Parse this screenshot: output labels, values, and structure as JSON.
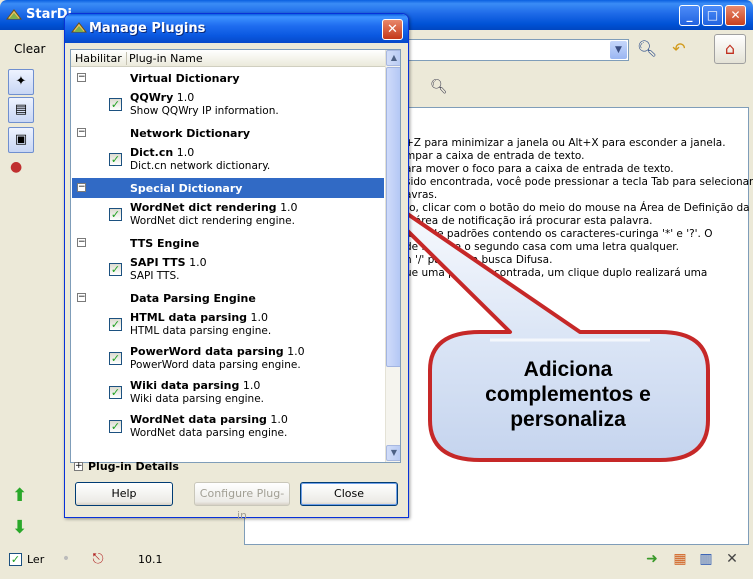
{
  "main_window": {
    "title": "StarDi",
    "toolbar": {
      "clear_label": "Clear"
    },
    "content_lines": [
      "+Z para minimizar a janela ou Alt+X para esconder a janela.",
      "mpar a caixa de entrada de texto.",
      "ara mover o foco para a caixa de entrada de texto.",
      "sido encontrada, você pode pressionar a tecla Tab para selecionar",
      "avras.",
      "to, clicar com o botão do meio do mouse na Área de Definição da",
      "a área de notificação irá procurar esta palavra.",
      "artir de padrões contendo os caracteres-curinga '*' e '?'. O",
      "de letras e o segundo casa com uma letra qualquer.",
      "n '/' para     uma busca Difusa.",
      "ue uma pa         foi encontrada, um clique duplo realizará uma"
    ],
    "status": {
      "read_label": "Ler",
      "version": "10.1"
    }
  },
  "dialog": {
    "title": "Manage Plugins",
    "close_symbol": "✕",
    "columns": {
      "enable": "Habilitar",
      "name": "Plug-in Name"
    },
    "categories": [
      {
        "name": "Virtual Dictionary",
        "expander": "−",
        "plugins": [
          {
            "name": "QQWry",
            "version": "1.0",
            "desc": "Show QQWry IP information.",
            "check": "✓"
          }
        ]
      },
      {
        "name": "Network Dictionary",
        "expander": "−",
        "plugins": [
          {
            "name": "Dict.cn",
            "version": "1.0",
            "desc": "Dict.cn network dictionary.",
            "check": "✓"
          }
        ]
      },
      {
        "name": "Special Dictionary",
        "expander": "−",
        "plugins": [
          {
            "name": "WordNet dict rendering",
            "version": "1.0",
            "desc": "WordNet dict rendering engine.",
            "check": "✓"
          }
        ]
      },
      {
        "name": "TTS Engine",
        "expander": "−",
        "plugins": [
          {
            "name": "SAPI TTS",
            "version": "1.0",
            "desc": "SAPI TTS.",
            "check": "✓"
          }
        ]
      },
      {
        "name": "Data Parsing Engine",
        "expander": "−",
        "plugins": [
          {
            "name": "HTML data parsing",
            "version": "1.0",
            "desc": "HTML data parsing engine.",
            "check": "✓"
          },
          {
            "name": "PowerWord data parsing",
            "version": "1.0",
            "desc": "PowerWord data parsing engine.",
            "check": "✓"
          },
          {
            "name": "Wiki data parsing",
            "version": "1.0",
            "desc": "Wiki data parsing engine.",
            "check": "✓"
          },
          {
            "name": "WordNet data parsing",
            "version": "1.0",
            "desc": "WordNet data parsing engine.",
            "check": "✓"
          }
        ]
      }
    ],
    "details": {
      "label": "Plug-in Details",
      "expander": "+"
    },
    "buttons": {
      "help": "Help",
      "configure": "Configure Plug-in",
      "close": "Close"
    }
  },
  "callout": {
    "lines": [
      "Adiciona",
      "complementos e",
      "personaliza"
    ]
  }
}
